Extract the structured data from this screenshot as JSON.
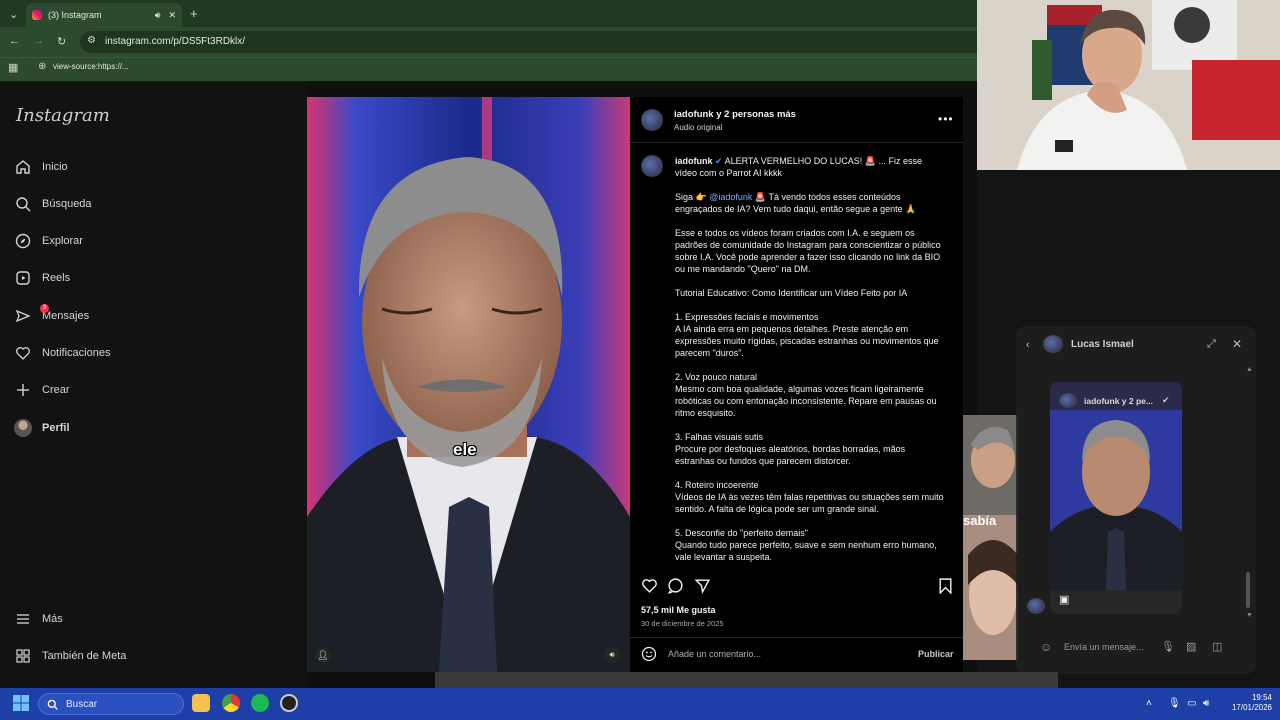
{
  "browser": {
    "tab_title": "(3) Instagram",
    "url": "instagram.com/p/DS5Ft3RDklx/",
    "bookmark": "view-source:https://..."
  },
  "sidebar": {
    "logo": "Instagram",
    "items": [
      {
        "label": "Inicio",
        "icon": "home-icon"
      },
      {
        "label": "Búsqueda",
        "icon": "search-icon"
      },
      {
        "label": "Explorar",
        "icon": "compass-icon"
      },
      {
        "label": "Reels",
        "icon": "reels-icon"
      },
      {
        "label": "Mensajes",
        "icon": "messenger-icon",
        "badge": "3"
      },
      {
        "label": "Notificaciones",
        "icon": "heart-icon"
      },
      {
        "label": "Crear",
        "icon": "plus-icon"
      },
      {
        "label": "Perfil",
        "icon": "avatar"
      }
    ],
    "more": "Más",
    "meta": "También de Meta"
  },
  "video": {
    "subtitle": "ele"
  },
  "post": {
    "header_name": "iadofunk y 2 personas más",
    "header_audio": "Audio original",
    "caption_user": "iadofunk",
    "caption_first": "ALERTA VERMELHO DO LUCAS! 🚨 ... Fiz esse vídeo com o Parrot AI kkkk",
    "p_siga_pre": "Siga 👉 ",
    "p_siga_mention": "@iadofunk",
    "p_siga_post": " 🚨 Tá vendo todos esses conteúdos engraçados de IA? Vem tudo daqui, então segue a gente 🙏",
    "p2": "Esse e todos os vídeos foram criados com I.A. e seguem os padrões de comunidade do Instagram para conscientizar o público sobre I.A. Você pode aprender a fazer isso clicando no link da BIO ou me mandando \"Quero\" na DM.",
    "p3": "Tutorial Educativo: Como Identificar um Vídeo Feito por IA",
    "p4": "1. Expressões faciais e movimentos\nA IA ainda erra em pequenos detalhes. Preste atenção em expressões muito rígidas, piscadas estranhas ou movimentos que parecem \"duros\".",
    "p5": "2. Voz pouco natural\nMesmo com boa qualidade, algumas vozes ficam ligeiramente robóticas ou com entonação inconsistente. Repare em pausas ou ritmo esquisito.",
    "p6": "3. Falhas visuais sutis\nProcure por desfoques aleatórios, bordas borradas, mãos estranhas ou fundos que parecem distorcer.",
    "p7": "4. Roteiro incoerente\nVídeos de IA às vezes têm falas repetitivas ou situações sem muito sentido. A falta de lógica pode ser um grande sinal.",
    "p8": "5. Desconfie do \"perfeito demais\"\nQuando tudo parece perfeito, suave e sem nenhum erro humano, vale levantar a suspeita.",
    "likes": "57,5 mil Me gusta",
    "date": "30 de diciembre de 2025",
    "comment_placeholder": "Añade un comentario...",
    "publish": "Publicar"
  },
  "dm": {
    "name": "Lucas Ismael",
    "card_title": "iadofunk y 2 pe...",
    "input_placeholder": "Envía un mensaje..."
  },
  "background_thumb_text": "sabía",
  "taskbar": {
    "search": "Buscar",
    "time": "19:54",
    "date": "17/01/2026"
  }
}
